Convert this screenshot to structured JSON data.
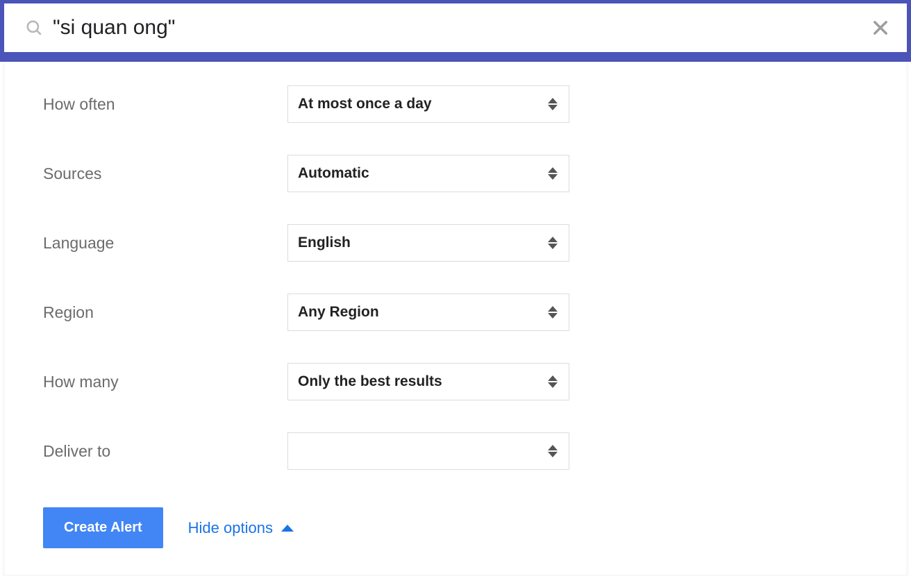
{
  "search": {
    "value": "\"si quan ong\""
  },
  "options": {
    "how_often": {
      "label": "How often",
      "value": "At most once a day"
    },
    "sources": {
      "label": "Sources",
      "value": "Automatic"
    },
    "language": {
      "label": "Language",
      "value": "English"
    },
    "region": {
      "label": "Region",
      "value": "Any Region"
    },
    "how_many": {
      "label": "How many",
      "value": "Only the best results"
    },
    "deliver_to": {
      "label": "Deliver to",
      "value": ""
    }
  },
  "actions": {
    "create_label": "Create Alert",
    "hide_label": "Hide options"
  }
}
